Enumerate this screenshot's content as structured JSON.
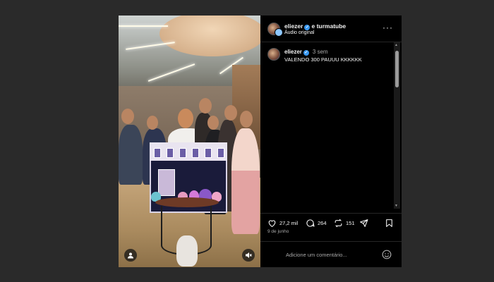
{
  "post": {
    "author": "eliezer",
    "connector": "e",
    "coauthor": "turmatube",
    "audio": "Áudio original",
    "more_label": "···"
  },
  "comment": {
    "user": "eliezer",
    "time": "3 sem",
    "text": "VALENDO 300 PAUUU KKKKKK"
  },
  "actions": {
    "likes": "27,2 mil",
    "comments": "264",
    "reposts": "151"
  },
  "date": "9 de junho",
  "input": {
    "placeholder": "Adicione um comentário..."
  },
  "overlay_icons": {
    "left": "user-tag-icon",
    "right": "mute-icon"
  },
  "colors": {
    "background": "#2a2a2a",
    "panel": "#000000",
    "verified": "#3897f0",
    "muted_text": "#a8a8a8"
  }
}
